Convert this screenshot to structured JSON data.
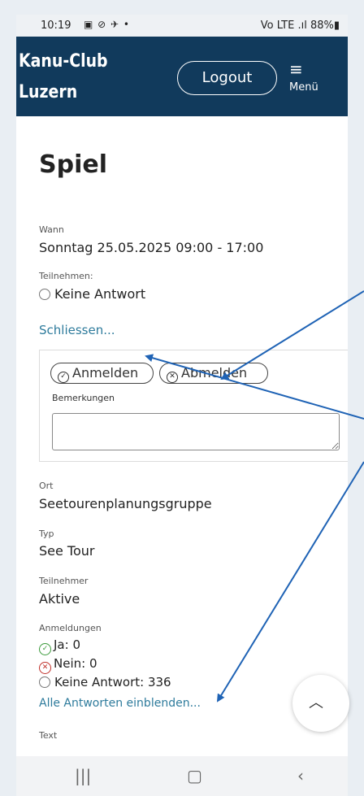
{
  "status_bar": {
    "time": "10:19",
    "left_icons": "▣ ⊘ ✈ •",
    "right": "Vo LTE .ıl 88%▮"
  },
  "header": {
    "brand": "Kanu-Club Luzern",
    "logout_label": "Logout",
    "menu_label": "Menü"
  },
  "page": {
    "title": "Spiel",
    "wann_label": "Wann",
    "wann_value": "Sonntag 25.05.2025 09:00 - 17:00",
    "teilnehmen_label": "Teilnehmen:",
    "teilnehmen_value": "Keine Antwort",
    "schliessen_link": "Schliessen...",
    "anmelden_label": "Anmelden",
    "abmelden_label": "Abmelden",
    "bemerkungen_label": "Bemerkungen",
    "ort_label": "Ort",
    "ort_value": "Seetourenplanungsgruppe",
    "typ_label": "Typ",
    "typ_value": "See Tour",
    "teilnehmer_label": "Teilnehmer",
    "teilnehmer_value": "Aktive",
    "anmeldungen_label": "Anmeldungen",
    "ja": "Ja: 0",
    "nein": "Nein: 0",
    "keine_antwort": "Keine Antwort: 336",
    "alle_antworten_link": "Alle Antworten einblenden...",
    "text_label": "Text"
  },
  "colors": {
    "header_bg": "#113a5c",
    "link": "#2e7b9c",
    "ja_green": "#3a9a3a",
    "nein_red": "#c0302a",
    "annotation_arrow": "#1f63b5"
  }
}
